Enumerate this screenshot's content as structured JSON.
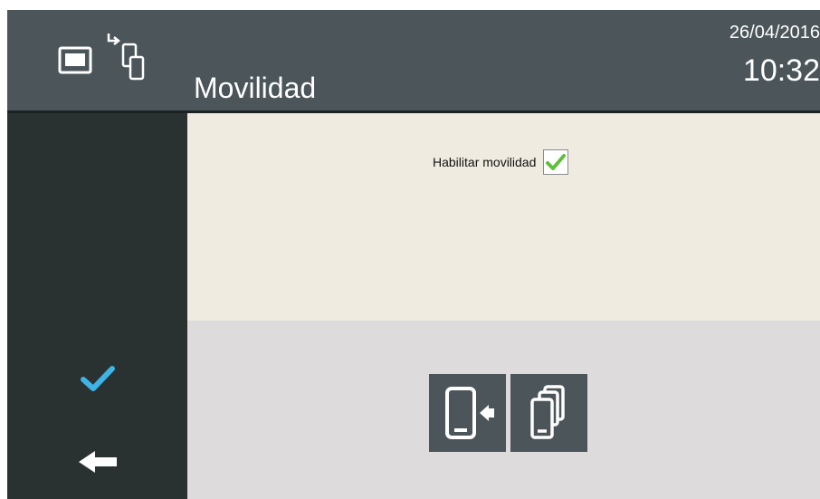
{
  "header": {
    "mode_icon": "mobility-transfer-icon",
    "title": "Movilidad",
    "date": "26/04/2016",
    "time": "10:32"
  },
  "content": {
    "option_label": "Habilitar movilidad",
    "option_checked": true
  },
  "sidebar": {
    "confirm_icon": "checkmark-icon",
    "back_icon": "back-arrow-icon"
  },
  "actions": {
    "pair_icon": "pair-phone-icon",
    "devices_icon": "multiple-devices-icon"
  },
  "colors": {
    "header_bg": "#4b555a",
    "sidebar_bg": "#2a3231",
    "content_bg": "#efebe0",
    "actions_bg": "#dedbdd",
    "accent_blue": "#3eb3e6",
    "check_green": "#5fbf3a"
  }
}
